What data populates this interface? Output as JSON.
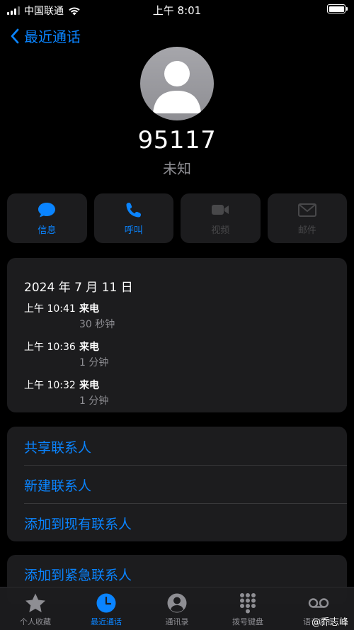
{
  "status": {
    "carrier": "中国联通",
    "time": "上午 8:01"
  },
  "nav": {
    "back_label": "最近通话"
  },
  "contact": {
    "number": "95117",
    "label": "未知"
  },
  "actions": [
    {
      "label": "信息",
      "icon": "message-icon",
      "enabled": true
    },
    {
      "label": "呼叫",
      "icon": "phone-icon",
      "enabled": true
    },
    {
      "label": "视频",
      "icon": "video-icon",
      "enabled": false
    },
    {
      "label": "邮件",
      "icon": "mail-icon",
      "enabled": false
    }
  ],
  "history": {
    "date": "2024 年 7 月 11 日",
    "calls": [
      {
        "time": "上午 10:41",
        "type": "来电",
        "duration": "30 秒钟"
      },
      {
        "time": "上午 10:36",
        "type": "来电",
        "duration": "1 分钟"
      },
      {
        "time": "上午 10:32",
        "type": "来电",
        "duration": "1 分钟"
      }
    ]
  },
  "options": [
    "共享联系人",
    "新建联系人",
    "添加到现有联系人"
  ],
  "emergency_option": "添加到紧急联系人",
  "tabs": [
    {
      "label": "个人收藏",
      "icon": "star-icon",
      "active": false
    },
    {
      "label": "最近通话",
      "icon": "clock-icon",
      "active": true
    },
    {
      "label": "通讯录",
      "icon": "person-icon",
      "active": false
    },
    {
      "label": "拨号键盘",
      "icon": "keypad-icon",
      "active": false
    },
    {
      "label": "语音留言",
      "icon": "voicemail-icon",
      "active": false
    }
  ],
  "watermark": "@乔志峰",
  "colors": {
    "accent": "#0a84ff",
    "background": "#000000",
    "card": "#1c1c1e",
    "secondary_text": "#8e8e93",
    "disabled": "#48484a"
  }
}
